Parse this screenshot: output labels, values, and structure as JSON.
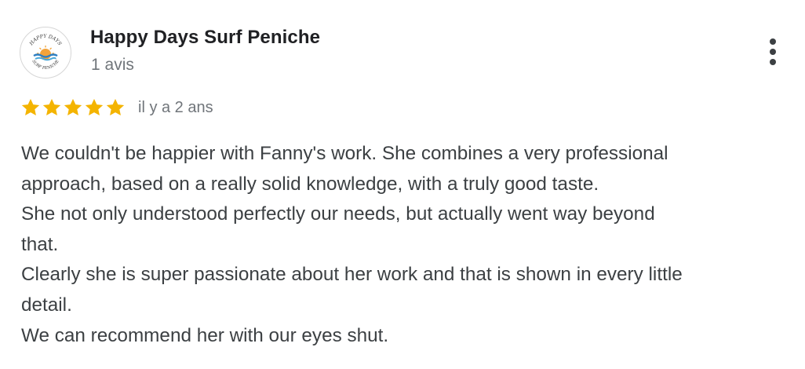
{
  "review": {
    "author": {
      "name": "Happy Days Surf Peniche",
      "meta": "1 avis",
      "avatar_icon": "happy-days-surf-logo",
      "avatar_text_top": "HAPPY DAYS",
      "avatar_text_bottom": "SURF PENICHE"
    },
    "menu_icon": "more-vert-icon",
    "rating": {
      "stars": 5,
      "max": 5,
      "star_color": "#f4b400",
      "date": "il y a 2 ans"
    },
    "text_lines": [
      "We couldn't be happier with Fanny's work. She combines a very professional",
      "approach, based on a really solid knowledge, with a truly good taste.",
      "She not only understood perfectly our needs, but actually went way beyond",
      "that.",
      "Clearly she is super passionate about her work and that is shown in every little",
      "detail.",
      "We can recommend her with our eyes shut."
    ]
  }
}
